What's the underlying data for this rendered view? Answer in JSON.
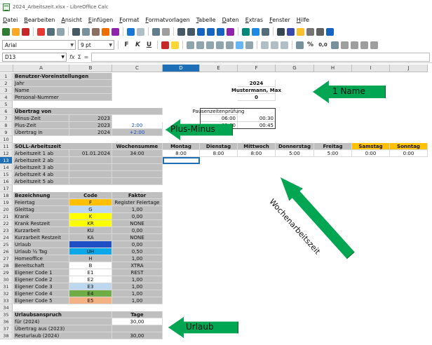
{
  "window": {
    "title": "2024_Arbeitszeit.xlsx - LibreOffice Calc"
  },
  "menu": [
    "Datei",
    "Bearbeiten",
    "Ansicht",
    "Einfügen",
    "Format",
    "Formatvorlagen",
    "Tabelle",
    "Daten",
    "Extras",
    "Fenster",
    "Hilfe"
  ],
  "format_bar": {
    "font_name": "Arial",
    "font_size": "9 pt",
    "bold": "F",
    "italic": "K",
    "underline": "U",
    "percent": "%",
    "decimal_format": "0,0"
  },
  "formula_bar": {
    "name_box": "D13",
    "fx": "fx",
    "sum": "Σ",
    "equals": "=",
    "content": ""
  },
  "columns": [
    "A",
    "B",
    "C",
    "D",
    "E",
    "F",
    "G",
    "H",
    "I",
    "J"
  ],
  "selected_column": "D",
  "selected_row": "13",
  "colors": {
    "yellow": "#ffff00",
    "orange": "#ffc000",
    "blue": "#1f4fc4",
    "sky": "#0aa8e8",
    "lightblue": "#bdd7ee",
    "green": "#70ad47",
    "peach": "#f4b183",
    "gray": "#bfbfbf",
    "arrow_green": "#00a651"
  },
  "rows": [
    {
      "n": "1",
      "cells": [
        {
          "col": "A",
          "text": "Benutzer-Voreinstellungen",
          "bold": true,
          "bg": "gray",
          "span": 2
        }
      ]
    },
    {
      "n": "2",
      "cells": [
        {
          "col": "A",
          "text": "Jahr",
          "bg": "gray",
          "span": 2
        },
        {
          "col": "F",
          "text": "2024",
          "bold": true,
          "align": "center"
        }
      ]
    },
    {
      "n": "3",
      "cells": [
        {
          "col": "A",
          "text": "Name",
          "bg": "gray",
          "span": 2
        },
        {
          "col": "F",
          "text": "Mustermann, Max",
          "bold": true,
          "align": "center"
        }
      ]
    },
    {
      "n": "4",
      "cells": [
        {
          "col": "A",
          "text": "Personal-Nummer",
          "bg": "gray",
          "span": 2
        },
        {
          "col": "F",
          "text": "0",
          "bold": true,
          "align": "center"
        }
      ]
    },
    {
      "n": "5",
      "cells": []
    },
    {
      "n": "6",
      "cells": [
        {
          "col": "A",
          "text": "Übertrag von",
          "bold": true,
          "bg": "gray",
          "span": 3
        },
        {
          "col": "E",
          "text": "Pausenzeitenprüfung",
          "align": "center"
        }
      ]
    },
    {
      "n": "7",
      "cells": [
        {
          "col": "A",
          "text": "Minus-Zeit",
          "bg": "gray"
        },
        {
          "col": "B",
          "text": "2023",
          "bg": "gray",
          "align": "right"
        },
        {
          "col": "E",
          "text": "06:00",
          "align": "right"
        },
        {
          "col": "F",
          "text": "00:30",
          "align": "right"
        }
      ]
    },
    {
      "n": "8",
      "cells": [
        {
          "col": "A",
          "text": "Plus-Zeit",
          "bg": "gray"
        },
        {
          "col": "B",
          "text": "2023",
          "bg": "gray",
          "align": "right"
        },
        {
          "col": "C",
          "text": "2:00",
          "align": "center",
          "color": "#1f4fc4"
        },
        {
          "col": "E",
          "text": "09:00",
          "align": "right"
        },
        {
          "col": "F",
          "text": "00:45",
          "align": "right"
        }
      ]
    },
    {
      "n": "9",
      "cells": [
        {
          "col": "A",
          "text": "Übertrag in",
          "bg": "gray"
        },
        {
          "col": "B",
          "text": "2024",
          "bg": "gray",
          "align": "right"
        },
        {
          "col": "C",
          "text": "+2:00",
          "align": "center",
          "color": "#1f4fc4",
          "bg": "gray"
        }
      ]
    },
    {
      "n": "10",
      "cells": []
    },
    {
      "n": "11",
      "cells": [
        {
          "col": "A",
          "text": "SOLL-Arbeitszeit",
          "bold": true,
          "bg": "gray",
          "span": 2
        },
        {
          "col": "C",
          "text": "Wochensumme",
          "bold": true,
          "bg": "gray",
          "align": "center"
        },
        {
          "col": "D",
          "text": "Montag",
          "bold": true,
          "bg": "gray",
          "align": "center"
        },
        {
          "col": "E",
          "text": "Dienstag",
          "bold": true,
          "bg": "gray",
          "align": "center"
        },
        {
          "col": "F",
          "text": "Mittwoch",
          "bold": true,
          "bg": "gray",
          "align": "center"
        },
        {
          "col": "G",
          "text": "Donnerstag",
          "bold": true,
          "bg": "gray",
          "align": "center"
        },
        {
          "col": "H",
          "text": "Freitag",
          "bold": true,
          "bg": "gray",
          "align": "center"
        },
        {
          "col": "I",
          "text": "Samstag",
          "bold": true,
          "bg": "orange",
          "align": "center"
        },
        {
          "col": "J",
          "text": "Sonntag",
          "bold": true,
          "bg": "orange",
          "align": "center"
        }
      ]
    },
    {
      "n": "12",
      "cells": [
        {
          "col": "A",
          "text": "Arbeitszeit 1 ab",
          "bg": "gray"
        },
        {
          "col": "B",
          "text": "01.01.2024",
          "bg": "gray",
          "align": "right"
        },
        {
          "col": "C",
          "text": "34:00",
          "bg": "gray",
          "align": "center"
        },
        {
          "col": "D",
          "text": "8:00",
          "align": "center"
        },
        {
          "col": "E",
          "text": "8:00",
          "align": "center"
        },
        {
          "col": "F",
          "text": "8:00",
          "align": "center"
        },
        {
          "col": "G",
          "text": "5:00",
          "align": "center"
        },
        {
          "col": "H",
          "text": "5:00",
          "align": "center"
        },
        {
          "col": "I",
          "text": "0:00",
          "align": "center"
        },
        {
          "col": "J",
          "text": "0:00",
          "align": "center"
        }
      ]
    },
    {
      "n": "13",
      "cells": [
        {
          "col": "A",
          "text": "Arbeitszeit 2 ab",
          "bg": "gray"
        },
        {
          "col": "B",
          "text": "",
          "bg": "gray"
        },
        {
          "col": "C",
          "text": "",
          "bg": "gray"
        }
      ]
    },
    {
      "n": "14",
      "cells": [
        {
          "col": "A",
          "text": "Arbeitszeit 3 ab",
          "bg": "gray"
        },
        {
          "col": "B",
          "text": "",
          "bg": "gray"
        },
        {
          "col": "C",
          "text": "",
          "bg": "gray"
        }
      ]
    },
    {
      "n": "15",
      "cells": [
        {
          "col": "A",
          "text": "Arbeitszeit 4 ab",
          "bg": "gray"
        },
        {
          "col": "B",
          "text": "",
          "bg": "gray"
        },
        {
          "col": "C",
          "text": "",
          "bg": "gray"
        }
      ]
    },
    {
      "n": "16",
      "cells": [
        {
          "col": "A",
          "text": "Arbeitszeit 5 ab",
          "bg": "gray"
        },
        {
          "col": "B",
          "text": "",
          "bg": "gray"
        },
        {
          "col": "C",
          "text": "",
          "bg": "gray"
        }
      ]
    },
    {
      "n": "17",
      "cells": []
    },
    {
      "n": "18",
      "cells": [
        {
          "col": "A",
          "text": "Bezeichnung",
          "bold": true,
          "bg": "gray"
        },
        {
          "col": "B",
          "text": "Code",
          "bold": true,
          "bg": "gray",
          "align": "center"
        },
        {
          "col": "C",
          "text": "Faktor",
          "bold": true,
          "bg": "gray",
          "align": "center"
        }
      ]
    },
    {
      "n": "19",
      "cells": [
        {
          "col": "A",
          "text": "Feiertag",
          "bg": "gray"
        },
        {
          "col": "B",
          "text": "F",
          "bg": "orange",
          "align": "center"
        },
        {
          "col": "C",
          "text": "Register Feiertage",
          "bg": "gray",
          "align": "center"
        }
      ]
    },
    {
      "n": "20",
      "cells": [
        {
          "col": "A",
          "text": "Gleittag",
          "bg": "gray"
        },
        {
          "col": "B",
          "text": "G",
          "bg": "lightblue",
          "align": "center"
        },
        {
          "col": "C",
          "text": "1,00",
          "bg": "gray",
          "align": "center"
        }
      ]
    },
    {
      "n": "21",
      "cells": [
        {
          "col": "A",
          "text": "Krank",
          "bg": "gray"
        },
        {
          "col": "B",
          "text": "K",
          "bg": "yellow",
          "align": "center"
        },
        {
          "col": "C",
          "text": "0,00",
          "bg": "gray",
          "align": "center"
        }
      ]
    },
    {
      "n": "22",
      "cells": [
        {
          "col": "A",
          "text": "Krank Restzeit",
          "bg": "gray"
        },
        {
          "col": "B",
          "text": "KR",
          "bg": "yellow",
          "align": "center"
        },
        {
          "col": "C",
          "text": "NONE",
          "bg": "gray",
          "align": "center"
        }
      ]
    },
    {
      "n": "23",
      "cells": [
        {
          "col": "A",
          "text": "Kurzarbeit",
          "bg": "gray"
        },
        {
          "col": "B",
          "text": "KU",
          "bg": "gray",
          "align": "center"
        },
        {
          "col": "C",
          "text": "0,00",
          "bg": "gray",
          "align": "center"
        }
      ]
    },
    {
      "n": "24",
      "cells": [
        {
          "col": "A",
          "text": "Kurzarbeit Restzeit",
          "bg": "gray"
        },
        {
          "col": "B",
          "text": "KA",
          "bg": "gray",
          "align": "center"
        },
        {
          "col": "C",
          "text": "NONE",
          "bg": "gray",
          "align": "center"
        }
      ]
    },
    {
      "n": "25",
      "cells": [
        {
          "col": "A",
          "text": "Urlaub",
          "bg": "gray"
        },
        {
          "col": "B",
          "text": "U",
          "bg": "blue",
          "align": "center"
        },
        {
          "col": "C",
          "text": "0,00",
          "bg": "gray",
          "align": "center"
        }
      ]
    },
    {
      "n": "26",
      "cells": [
        {
          "col": "A",
          "text": "Urlaub ½ Tag",
          "bg": "gray"
        },
        {
          "col": "B",
          "text": "UH",
          "bg": "sky",
          "align": "center"
        },
        {
          "col": "C",
          "text": "0,50",
          "bg": "gray",
          "align": "center"
        }
      ]
    },
    {
      "n": "27",
      "cells": [
        {
          "col": "A",
          "text": "Homeoffice",
          "bg": "gray"
        },
        {
          "col": "B",
          "text": "H",
          "bg": "gray",
          "align": "center"
        },
        {
          "col": "C",
          "text": "1,00",
          "bg": "gray",
          "align": "center"
        }
      ]
    },
    {
      "n": "28",
      "cells": [
        {
          "col": "A",
          "text": "Bereitschaft",
          "bg": "gray"
        },
        {
          "col": "B",
          "text": "B",
          "align": "center"
        },
        {
          "col": "C",
          "text": "XTRA",
          "bg": "gray",
          "align": "center"
        }
      ]
    },
    {
      "n": "29",
      "cells": [
        {
          "col": "A",
          "text": "Eigener Code 1",
          "bg": "gray"
        },
        {
          "col": "B",
          "text": "E1",
          "align": "center"
        },
        {
          "col": "C",
          "text": "REST",
          "bg": "gray",
          "align": "center"
        }
      ]
    },
    {
      "n": "30",
      "cells": [
        {
          "col": "A",
          "text": "Eigener Code 2",
          "bg": "gray"
        },
        {
          "col": "B",
          "text": "E2",
          "align": "center"
        },
        {
          "col": "C",
          "text": "1,00",
          "bg": "gray",
          "align": "center"
        }
      ]
    },
    {
      "n": "31",
      "cells": [
        {
          "col": "A",
          "text": "Eigener Code 3",
          "bg": "gray"
        },
        {
          "col": "B",
          "text": "E3",
          "bg": "lightblue",
          "align": "center"
        },
        {
          "col": "C",
          "text": "1,00",
          "bg": "gray",
          "align": "center"
        }
      ]
    },
    {
      "n": "32",
      "cells": [
        {
          "col": "A",
          "text": "Eigener Code 4",
          "bg": "gray"
        },
        {
          "col": "B",
          "text": "E4",
          "bg": "green",
          "align": "center"
        },
        {
          "col": "C",
          "text": "1,00",
          "bg": "gray",
          "align": "center"
        }
      ]
    },
    {
      "n": "33",
      "cells": [
        {
          "col": "A",
          "text": "Eigener Code 5",
          "bg": "gray"
        },
        {
          "col": "B",
          "text": "E5",
          "bg": "peach",
          "align": "center"
        },
        {
          "col": "C",
          "text": "1,00",
          "bg": "gray",
          "align": "center"
        }
      ]
    },
    {
      "n": "34",
      "cells": []
    },
    {
      "n": "35",
      "cells": [
        {
          "col": "A",
          "text": "Urlaubsanspruch",
          "bold": true,
          "bg": "gray",
          "span": 2
        },
        {
          "col": "C",
          "text": "Tage",
          "bold": true,
          "bg": "gray",
          "align": "center"
        }
      ]
    },
    {
      "n": "36",
      "cells": [
        {
          "col": "A",
          "text": "für (2024)",
          "bg": "gray",
          "span": 2
        },
        {
          "col": "C",
          "text": "30,00",
          "align": "center"
        }
      ]
    },
    {
      "n": "37",
      "cells": [
        {
          "col": "A",
          "text": "Übertrag aus (2023)",
          "bg": "gray",
          "span": 2
        },
        {
          "col": "C",
          "text": "",
          "bg": "gray"
        }
      ]
    },
    {
      "n": "38",
      "cells": [
        {
          "col": "A",
          "text": "Resturlaub (2024)",
          "bg": "gray",
          "span": 2
        },
        {
          "col": "C",
          "text": "30,00",
          "bg": "gray",
          "align": "center"
        }
      ]
    }
  ],
  "annotations": {
    "name": "1 Name",
    "plus_minus": "Plus-Minus",
    "weekly": "Wochenarbeitszeit",
    "vacation": "Urlaub"
  }
}
